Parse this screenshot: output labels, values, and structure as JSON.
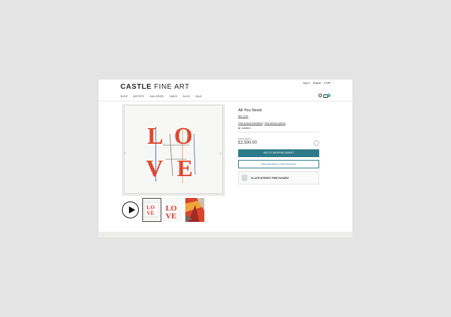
{
  "header": {
    "logo_bold": "CASTLE",
    "logo_light": "FINE ART",
    "sign_in": "Sign In",
    "register": "Register",
    "currency": "£ GBP"
  },
  "nav": {
    "items": [
      {
        "label": "SHOP"
      },
      {
        "label": "ARTISTS"
      },
      {
        "label": "GALLERIES"
      },
      {
        "label": "VIDEO"
      },
      {
        "label": "BLOG"
      },
      {
        "label": "SALE"
      }
    ],
    "basket_count": "0"
  },
  "product": {
    "title": "All You Need",
    "artist": "BEL 2022",
    "image_word": "LOVE",
    "links": {
      "description": "View product description",
      "delivery": "View delivery options"
    },
    "availability": "Available",
    "price_label": "PRICE FROM",
    "price": "£2,500.00",
    "add_to_basket": "ADD TO SHOPPING BASKET",
    "enquire": "ENQUIRE ABOUT THIS PRODUCT",
    "finance": "0% APR INTEREST FREE PAYMENT"
  },
  "colors": {
    "accent": "#2c7a8a",
    "badge": "#36a9a3",
    "art_red": "#e0382d"
  },
  "icons": {
    "search": "search-icon",
    "basket": "basket-icon",
    "play": "play-icon",
    "info": "info-icon",
    "finance": "finance-icon"
  }
}
